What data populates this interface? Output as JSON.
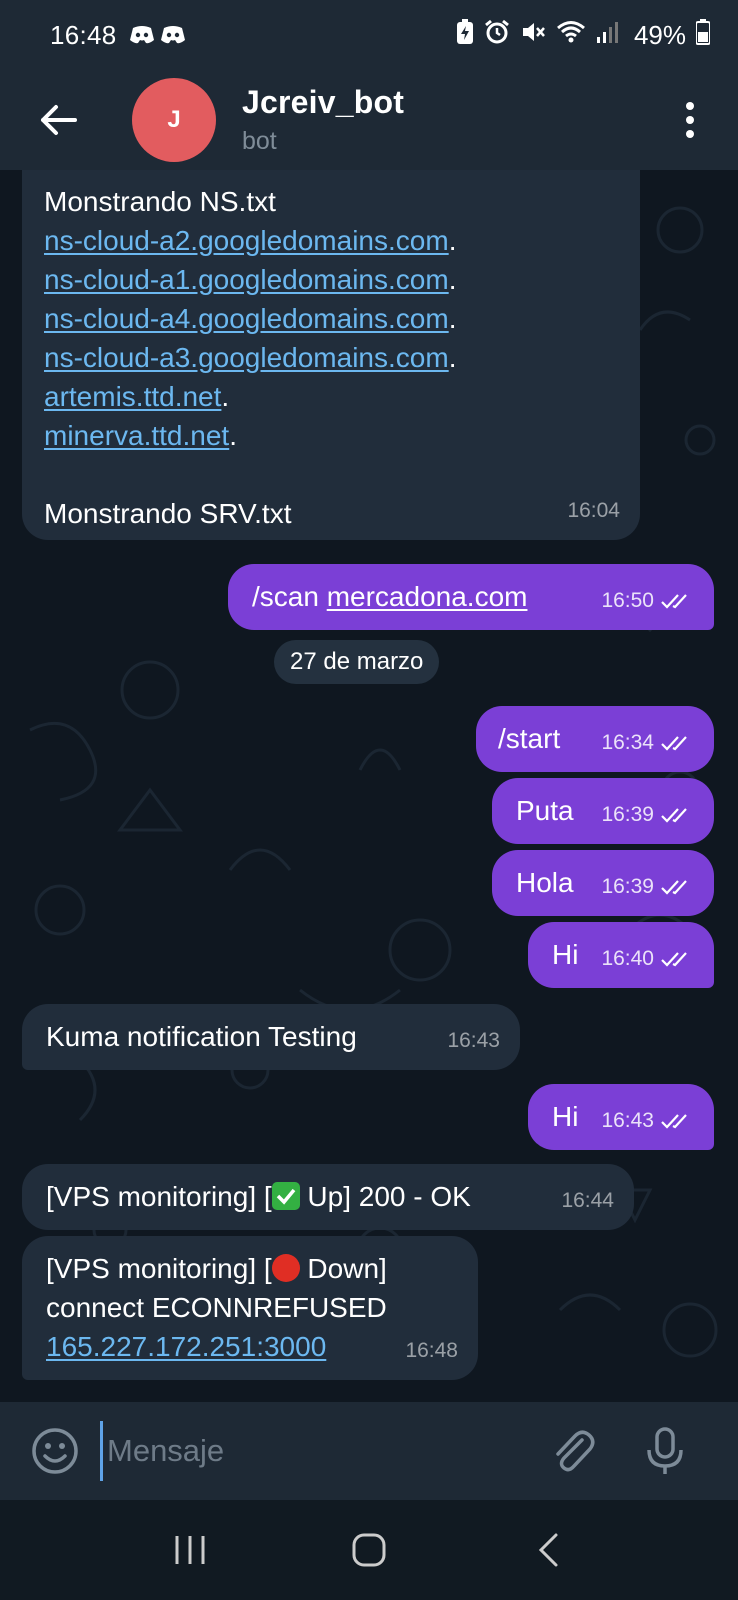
{
  "status_bar": {
    "time": "16:48",
    "battery_percent": "49%",
    "icons": [
      "discord-icon",
      "battery-saver-icon",
      "alarm-icon",
      "mute-icon",
      "wifi-icon",
      "signal-icon",
      "battery-icon"
    ]
  },
  "header": {
    "title": "Jcreiv_bot",
    "subtitle": "bot",
    "avatar_letter": "J",
    "avatar_color": "#e25c5f"
  },
  "messages": [
    {
      "dir": "in",
      "lines": [
        "Monstrando NS.txt",
        "ns-cloud-a2.googledomains.com",
        "ns-cloud-a1.googledomains.com",
        "ns-cloud-a4.googledomains.com",
        "ns-cloud-a3.googledomains.com",
        "artemis.ttd.net",
        "minerva.ttd.net",
        "",
        "Monstrando SRV.txt"
      ],
      "time": "16:04"
    },
    {
      "dir": "out",
      "prefix": "/scan ",
      "link": "mercadona.com",
      "time": "16:50"
    },
    {
      "dir": "out",
      "text": "/start",
      "time": "16:34"
    },
    {
      "dir": "out",
      "text": "Puta",
      "time": "16:39"
    },
    {
      "dir": "out",
      "text": "Hola",
      "time": "16:39"
    },
    {
      "dir": "out",
      "text": "Hi",
      "time": "16:40"
    },
    {
      "dir": "in",
      "text": "Kuma notification Testing",
      "time": "16:43"
    },
    {
      "dir": "out",
      "text": "Hi",
      "time": "16:43"
    },
    {
      "dir": "in",
      "text_a": "[VPS monitoring] [",
      "text_b": " Up] 200 - OK",
      "time": "16:44"
    },
    {
      "dir": "in",
      "line1_a": "[VPS monitoring] [",
      "line1_b": " Down]",
      "line2": "connect ECONNREFUSED",
      "link": "165.227.172.251:3000",
      "time": "16:48"
    }
  ],
  "date_separator": "27 de marzo",
  "composer": {
    "placeholder": "Mensaje"
  },
  "colors": {
    "incoming_bubble": "#212d3b",
    "outgoing_bubble": "#7b3fd6",
    "link": "#6cb8f0",
    "background": "#0f1720",
    "bar": "#1e2935"
  }
}
